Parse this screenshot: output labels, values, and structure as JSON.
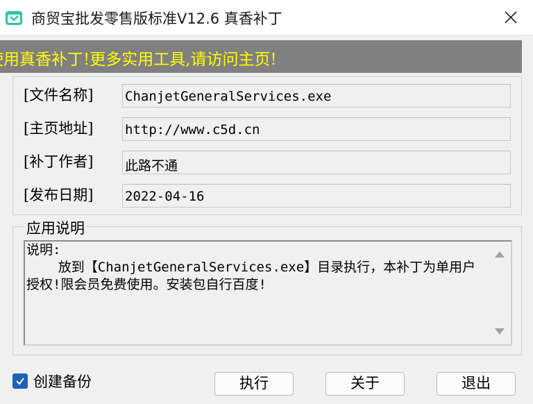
{
  "window": {
    "title": "商贸宝批发零售版标准V12.6 真香补丁",
    "app_icon": "app-logo-icon",
    "close_icon": "close-icon"
  },
  "banner": {
    "text": "使用真香补丁!更多实用工具,请访问主页!",
    "background": "#808080",
    "text_color": "#ffff00"
  },
  "info": {
    "rows": [
      {
        "label": "[文件名称]",
        "value": "ChanjetGeneralServices.exe"
      },
      {
        "label": "[主页地址]",
        "value": "http://www.c5d.cn"
      },
      {
        "label": "[补丁作者]",
        "value": "此路不通"
      },
      {
        "label": "[发布日期]",
        "value": "2022-04-16"
      }
    ]
  },
  "description": {
    "legend": "应用说明",
    "text": "说明:\n    放到【ChanjetGeneralServices.exe】目录执行，本补丁为单用户授权!限会员免费使用。安装包自行百度!"
  },
  "footer": {
    "backup_label": "创建备份",
    "backup_checked": true,
    "checkbox_color": "#1c62b8",
    "buttons": {
      "execute": "执行",
      "about": "关于",
      "exit": "退出"
    }
  }
}
